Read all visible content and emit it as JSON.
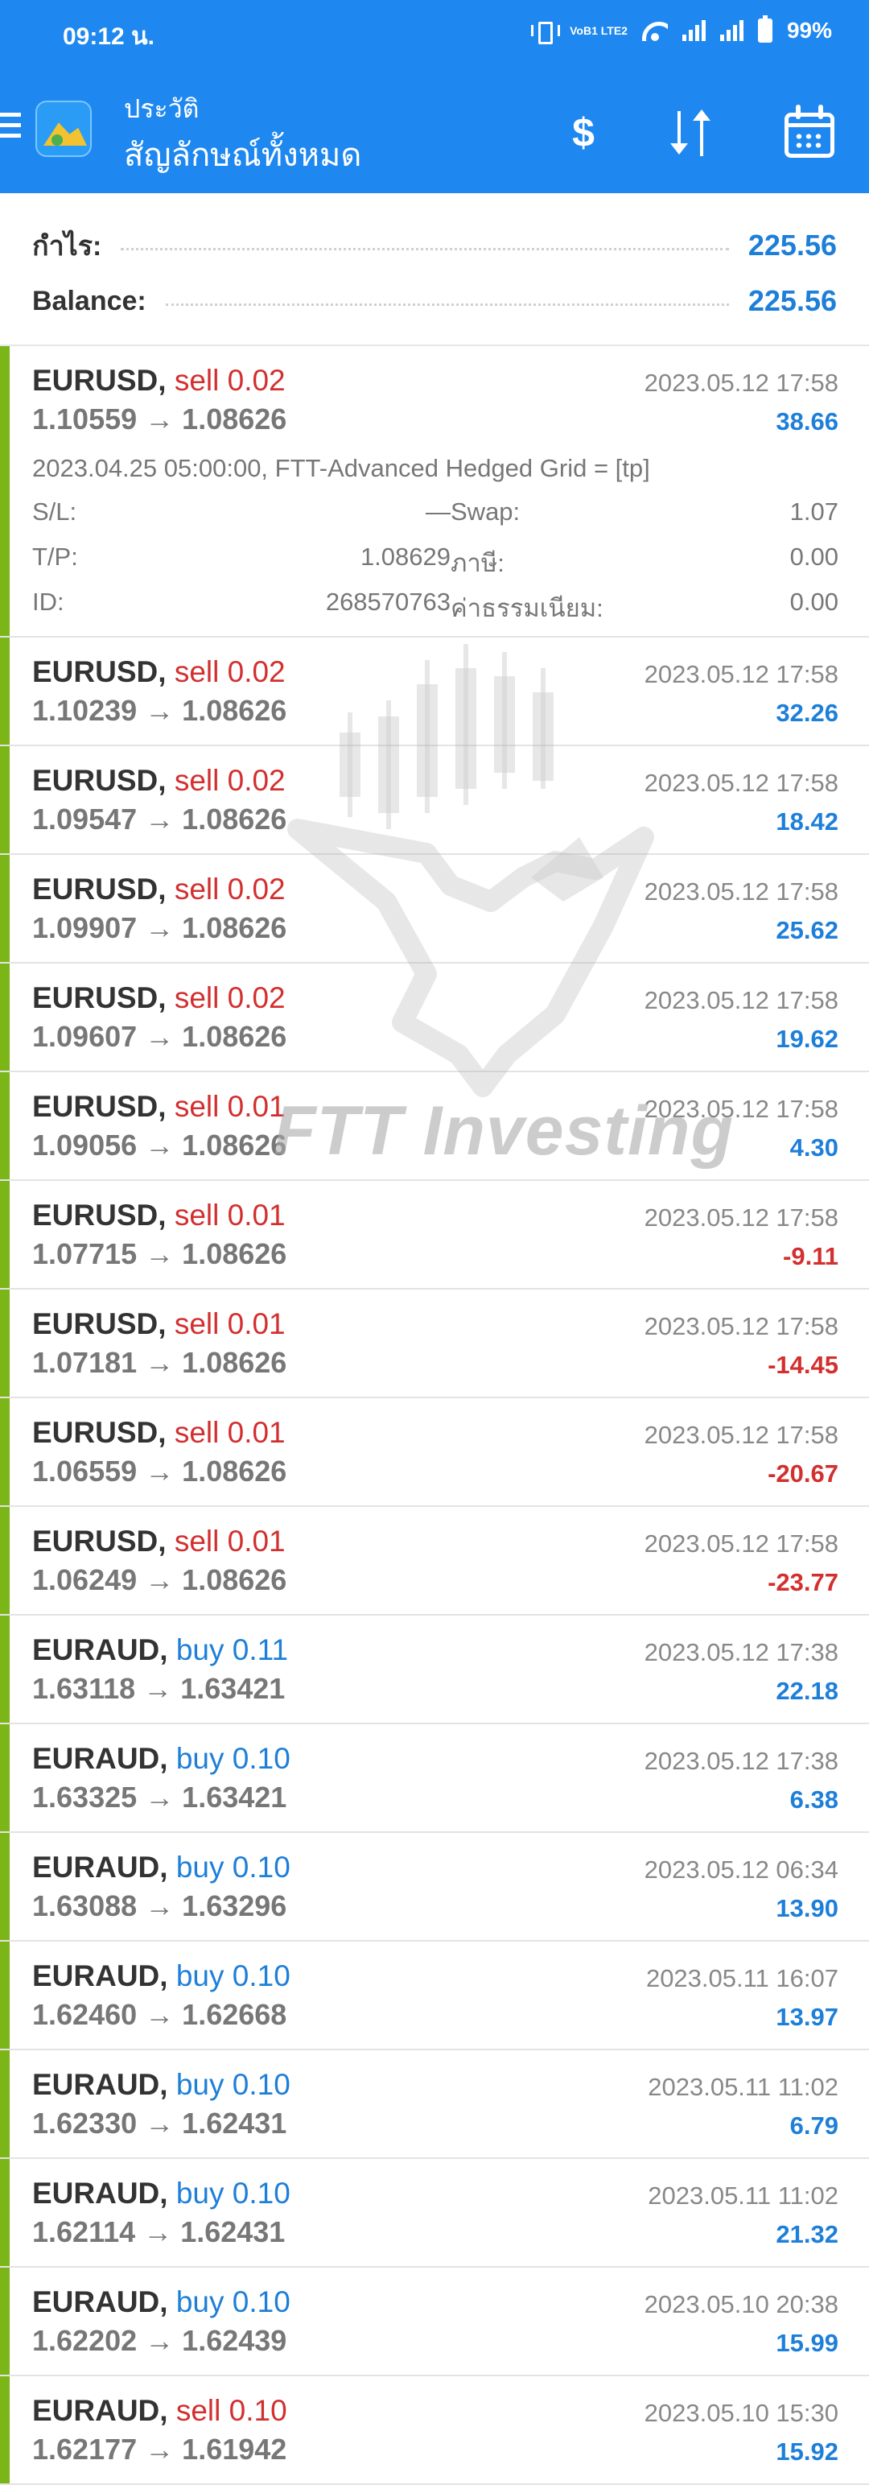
{
  "status_bar": {
    "time": "09:12 น.",
    "network": "VoB1 LTE2",
    "battery": "99%"
  },
  "header": {
    "subtitle": "ประวัติ",
    "title": "สัญลักษณ์ทั้งหมด",
    "dollar_icon": "$"
  },
  "summary": {
    "profit_label": "กำไร:",
    "profit_value": "225.56",
    "balance_label": "Balance:",
    "balance_value": "225.56"
  },
  "trades": [
    {
      "symbol": "EURUSD,",
      "side": "sell 0.02",
      "dir": "sell",
      "open": "1.10559",
      "close": "1.08626",
      "date": "2023.05.12 17:58",
      "profit": "38.66",
      "sign": "pos",
      "details": {
        "comment": "2023.04.25 05:00:00, FTT-Advanced Hedged Grid = [tp]",
        "sl_label": "S/L:",
        "sl": "—",
        "swap_label": "Swap:",
        "swap": "1.07",
        "tp_label": "T/P:",
        "tp": "1.08629",
        "tax_label": "ภาษี:",
        "tax": "0.00",
        "id_label": "ID:",
        "id": "268570763",
        "fee_label": "ค่าธรรมเนียม:",
        "fee": "0.00"
      }
    },
    {
      "symbol": "EURUSD,",
      "side": "sell 0.02",
      "dir": "sell",
      "open": "1.10239",
      "close": "1.08626",
      "date": "2023.05.12 17:58",
      "profit": "32.26",
      "sign": "pos"
    },
    {
      "symbol": "EURUSD,",
      "side": "sell 0.02",
      "dir": "sell",
      "open": "1.09547",
      "close": "1.08626",
      "date": "2023.05.12 17:58",
      "profit": "18.42",
      "sign": "pos"
    },
    {
      "symbol": "EURUSD,",
      "side": "sell 0.02",
      "dir": "sell",
      "open": "1.09907",
      "close": "1.08626",
      "date": "2023.05.12 17:58",
      "profit": "25.62",
      "sign": "pos"
    },
    {
      "symbol": "EURUSD,",
      "side": "sell 0.02",
      "dir": "sell",
      "open": "1.09607",
      "close": "1.08626",
      "date": "2023.05.12 17:58",
      "profit": "19.62",
      "sign": "pos"
    },
    {
      "symbol": "EURUSD,",
      "side": "sell 0.01",
      "dir": "sell",
      "open": "1.09056",
      "close": "1.08626",
      "date": "2023.05.12 17:58",
      "profit": "4.30",
      "sign": "pos"
    },
    {
      "symbol": "EURUSD,",
      "side": "sell 0.01",
      "dir": "sell",
      "open": "1.07715",
      "close": "1.08626",
      "date": "2023.05.12 17:58",
      "profit": "-9.11",
      "sign": "neg"
    },
    {
      "symbol": "EURUSD,",
      "side": "sell 0.01",
      "dir": "sell",
      "open": "1.07181",
      "close": "1.08626",
      "date": "2023.05.12 17:58",
      "profit": "-14.45",
      "sign": "neg"
    },
    {
      "symbol": "EURUSD,",
      "side": "sell 0.01",
      "dir": "sell",
      "open": "1.06559",
      "close": "1.08626",
      "date": "2023.05.12 17:58",
      "profit": "-20.67",
      "sign": "neg"
    },
    {
      "symbol": "EURUSD,",
      "side": "sell 0.01",
      "dir": "sell",
      "open": "1.06249",
      "close": "1.08626",
      "date": "2023.05.12 17:58",
      "profit": "-23.77",
      "sign": "neg"
    },
    {
      "symbol": "EURAUD,",
      "side": "buy 0.11",
      "dir": "buy",
      "open": "1.63118",
      "close": "1.63421",
      "date": "2023.05.12 17:38",
      "profit": "22.18",
      "sign": "pos"
    },
    {
      "symbol": "EURAUD,",
      "side": "buy 0.10",
      "dir": "buy",
      "open": "1.63325",
      "close": "1.63421",
      "date": "2023.05.12 17:38",
      "profit": "6.38",
      "sign": "pos"
    },
    {
      "symbol": "EURAUD,",
      "side": "buy 0.10",
      "dir": "buy",
      "open": "1.63088",
      "close": "1.63296",
      "date": "2023.05.12 06:34",
      "profit": "13.90",
      "sign": "pos"
    },
    {
      "symbol": "EURAUD,",
      "side": "buy 0.10",
      "dir": "buy",
      "open": "1.62460",
      "close": "1.62668",
      "date": "2023.05.11 16:07",
      "profit": "13.97",
      "sign": "pos"
    },
    {
      "symbol": "EURAUD,",
      "side": "buy 0.10",
      "dir": "buy",
      "open": "1.62330",
      "close": "1.62431",
      "date": "2023.05.11 11:02",
      "profit": "6.79",
      "sign": "pos"
    },
    {
      "symbol": "EURAUD,",
      "side": "buy 0.10",
      "dir": "buy",
      "open": "1.62114",
      "close": "1.62431",
      "date": "2023.05.11 11:02",
      "profit": "21.32",
      "sign": "pos"
    },
    {
      "symbol": "EURAUD,",
      "side": "buy 0.10",
      "dir": "buy",
      "open": "1.62202",
      "close": "1.62439",
      "date": "2023.05.10 20:38",
      "profit": "15.99",
      "sign": "pos"
    },
    {
      "symbol": "EURAUD,",
      "side": "sell 0.10",
      "dir": "sell",
      "open": "1.62177",
      "close": "1.61942",
      "date": "2023.05.10 15:30",
      "profit": "15.92",
      "sign": "pos"
    }
  ],
  "arrow": "→",
  "watermark": "FTT Investing",
  "colors": {
    "header": "#1e88f0",
    "accent": "#1e7fd8",
    "loss": "#d32f2f",
    "bar": "#7cb518"
  }
}
